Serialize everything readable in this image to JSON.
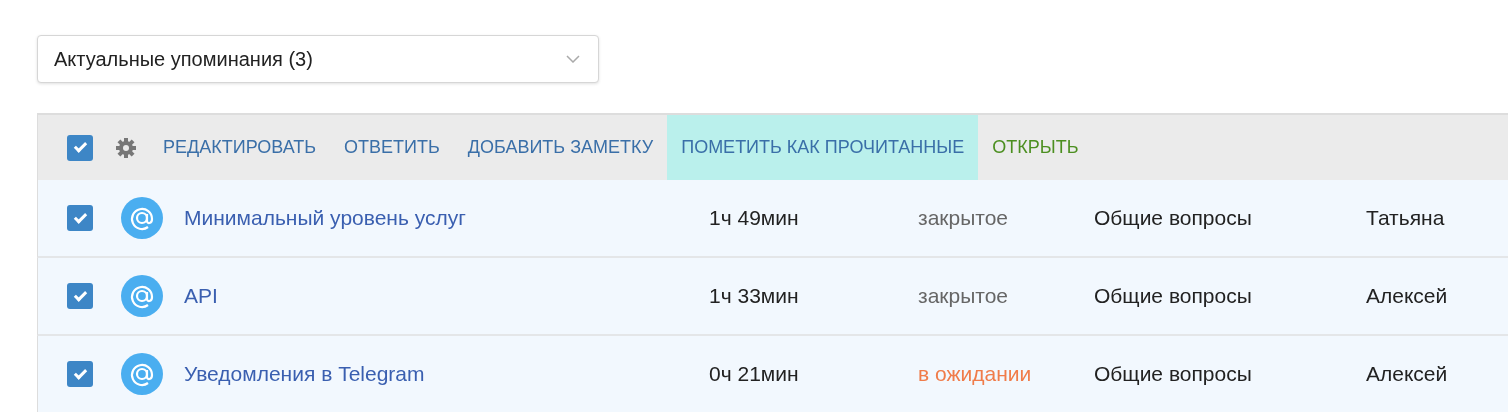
{
  "filter": {
    "value": "Актуальные упоминания (3)"
  },
  "toolbar": {
    "select_all": {
      "checked": true
    },
    "actions": [
      {
        "label": "РЕДАКТИРОВАТЬ",
        "kind": "action",
        "highlighted": false
      },
      {
        "label": "ОТВЕТИТЬ",
        "kind": "action",
        "highlighted": false
      },
      {
        "label": "ДОБАВИТЬ ЗАМЕТКУ",
        "kind": "action",
        "highlighted": false
      },
      {
        "label": "ПОМЕТИТЬ КАК ПРОЧИТАННЫЕ",
        "kind": "action",
        "highlighted": true
      },
      {
        "label": "ОТКРЫТЬ",
        "kind": "open",
        "highlighted": false
      }
    ]
  },
  "rows": [
    {
      "checked": true,
      "title": "Минимальный уровень услуг",
      "time": "1ч 49мин",
      "status": {
        "text": "закрытое",
        "kind": "closed"
      },
      "category": "Общие вопросы",
      "person": "Татьяна"
    },
    {
      "checked": true,
      "title": "API",
      "time": "1ч 33мин",
      "status": {
        "text": "закрытое",
        "kind": "closed"
      },
      "category": "Общие вопросы",
      "person": "Алексей"
    },
    {
      "checked": true,
      "title": "Уведомления в Telegram",
      "time": "0ч 21мин",
      "status": {
        "text": "в ожидании",
        "kind": "pending"
      },
      "category": "Общие вопросы",
      "person": "Алексей"
    }
  ]
}
